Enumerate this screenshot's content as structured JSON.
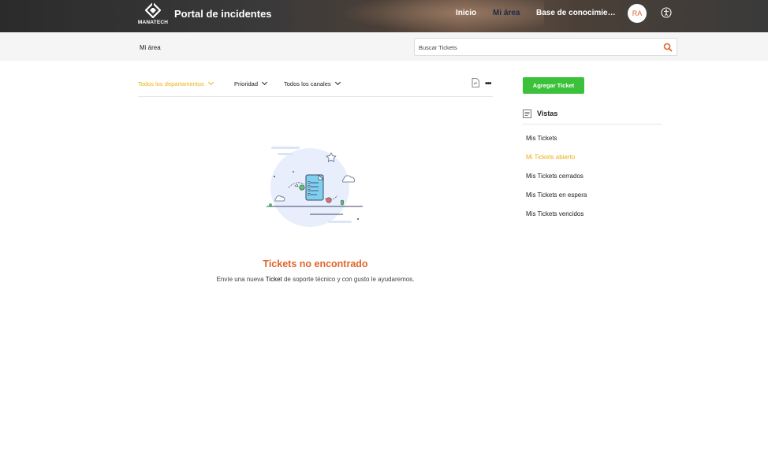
{
  "header": {
    "logo_text": "MANATECH",
    "title": "Portal de incidentes",
    "nav": [
      "Inicio",
      "Mi área",
      "Base de conocimien..."
    ],
    "avatar_initials": "RA",
    "brand_color": "#e0652c"
  },
  "subheader": {
    "breadcrumb": "Mi área",
    "search_placeholder": "Buscar Tickets"
  },
  "filters": {
    "department": "Todos los departamentos",
    "priority": "Prioridad",
    "channel": "Todos los canales"
  },
  "empty_state": {
    "title": "Tickets no encontrado",
    "message_before": "Envíe una nueva ",
    "message_link": "Ticket",
    "message_after": " de soporte técnico y con gusto le ayudaremos."
  },
  "sidebar": {
    "add_button": "Agregar Ticket",
    "views_title": "Vistas",
    "views": [
      "Mis Tickets",
      "Mi Tickets abierto",
      "Mis Tickets cerrados",
      "Mis Tickets en espera",
      "Mis Tickets vencidos"
    ],
    "active_view_index": 1
  },
  "colors": {
    "accent": "#e8b315",
    "button_green": "#3cc13b",
    "title_orange": "#e0652c"
  }
}
